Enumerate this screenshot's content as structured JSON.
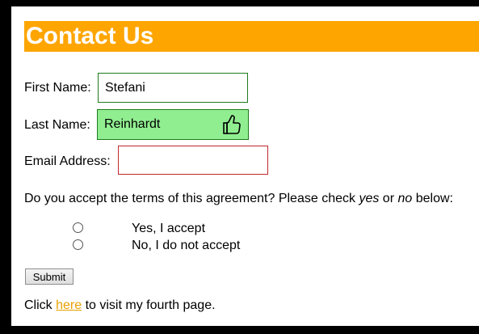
{
  "header": {
    "title": "Contact Us"
  },
  "form": {
    "first_name_label": "First Name:",
    "first_name_value": "Stefani",
    "last_name_label": "Last Name:",
    "last_name_value": "Reinhardt",
    "email_label": "Email Address:",
    "email_value": "",
    "terms_text_before": "Do you accept the terms of this agreement? Please check ",
    "terms_yes": "yes",
    "terms_or": " or ",
    "terms_no": "no",
    "terms_text_after": " below:",
    "options": [
      {
        "label": "Yes, I accept",
        "checked": false
      },
      {
        "label": "No, I do not accept",
        "checked": false
      }
    ],
    "submit_label": "Submit"
  },
  "footer": {
    "text_before": "Click ",
    "link_text": "here",
    "text_after": " to visit my fourth page."
  },
  "colors": {
    "banner": "#ffa500",
    "last_name_bg": "#90ee90",
    "email_border": "#c0282d",
    "link": "#e8a000"
  },
  "icons": {
    "cursor": "thumbs-up-hand-icon"
  }
}
